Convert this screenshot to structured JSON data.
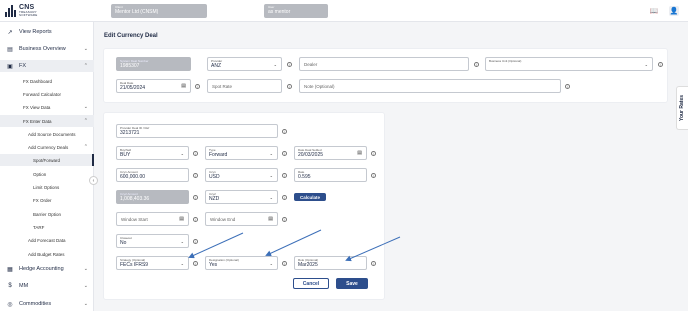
{
  "brand": {
    "name": "CNS",
    "sub1": "TREASURY",
    "sub2": "SOFTWARE"
  },
  "context": {
    "client": {
      "label": "Client",
      "value": "Mentor Ltd (CNSM)"
    },
    "user": {
      "label": "User",
      "value": "as mentor"
    }
  },
  "topbar_icons": [
    "books-icon",
    "user-icon"
  ],
  "sidebar": {
    "items": [
      {
        "label": "View Reports",
        "icon": "chart-icon"
      },
      {
        "label": "Business Overview",
        "icon": "folder-icon"
      },
      {
        "label": "FX",
        "icon": "fx-icon"
      },
      {
        "label": "FX Dashboard"
      },
      {
        "label": "Forward Calculator"
      },
      {
        "label": "FX View Data"
      },
      {
        "label": "FX Enter Data"
      },
      {
        "label": "Add Source Documents"
      },
      {
        "label": "Add Currency Deals"
      },
      {
        "label": "Spot/Forward"
      },
      {
        "label": "Option"
      },
      {
        "label": "Limit Options"
      },
      {
        "label": "FX Order"
      },
      {
        "label": "Barrier Option"
      },
      {
        "label": "TARF"
      },
      {
        "label": "Add Forecast Data"
      },
      {
        "label": "Add Budget Rates"
      },
      {
        "label": "Hedge Accounting",
        "icon": "hedge-icon"
      },
      {
        "label": "MM",
        "icon": "dollar-icon"
      },
      {
        "label": "Commodities",
        "icon": "globe-icon"
      }
    ]
  },
  "page_title": "Edit Currency Deal",
  "top_form": {
    "system_deal_number": {
      "label": "System Deal Number",
      "value": "1985307"
    },
    "provider": {
      "label": "Provider",
      "value": "ANZ"
    },
    "dealer": {
      "placeholder": "Dealer"
    },
    "business_unit": {
      "label": "Business Unit (Optional)",
      "value": ""
    },
    "deal_date": {
      "label": "Deal Date",
      "value": "21/05/2024"
    },
    "spot_rate": {
      "placeholder": "Spot Rate"
    },
    "note": {
      "placeholder": "Note (Optional)"
    }
  },
  "deal_form": {
    "provider_deal_id": {
      "label": "Provider Deal ID / Ref",
      "value": "3213721"
    },
    "buy_sell": {
      "label": "Buy/Sell",
      "value": "BUY"
    },
    "type": {
      "label": "Type",
      "value": "Forward"
    },
    "date_settled": {
      "label": "Date Deal Settled",
      "value": "20/03/2025"
    },
    "ccy1_amount": {
      "label": "Ccy1 Amount",
      "value": "600,000.00"
    },
    "ccy1": {
      "label": "Ccy1",
      "value": "USD"
    },
    "rate": {
      "label": "Rate",
      "value": "0.595"
    },
    "ccy2_amount": {
      "label": "Ccy2 Amount",
      "value": "1,008,403.36"
    },
    "ccy2": {
      "label": "Ccy2",
      "value": "NZD"
    },
    "calculate": "Calculate",
    "window_start": {
      "placeholder": "Window Start"
    },
    "window_end": {
      "placeholder": "Window End"
    },
    "closeout": {
      "label": "Closeout",
      "value": "No"
    },
    "strategy": {
      "label": "Strategy (Optional)",
      "value": "FECs IFRS9"
    },
    "designation": {
      "label": "Designation (Optional)",
      "value": "Yes"
    },
    "role": {
      "label": "Role (Optional)",
      "value": "Mar2025"
    },
    "cancel": "Cancel",
    "save": "Save"
  },
  "side_tab": "Your Rates",
  "colors": {
    "primary": "#2d4e8c",
    "arrow": "#3c6fb8",
    "disabled": "#b7bac0"
  }
}
